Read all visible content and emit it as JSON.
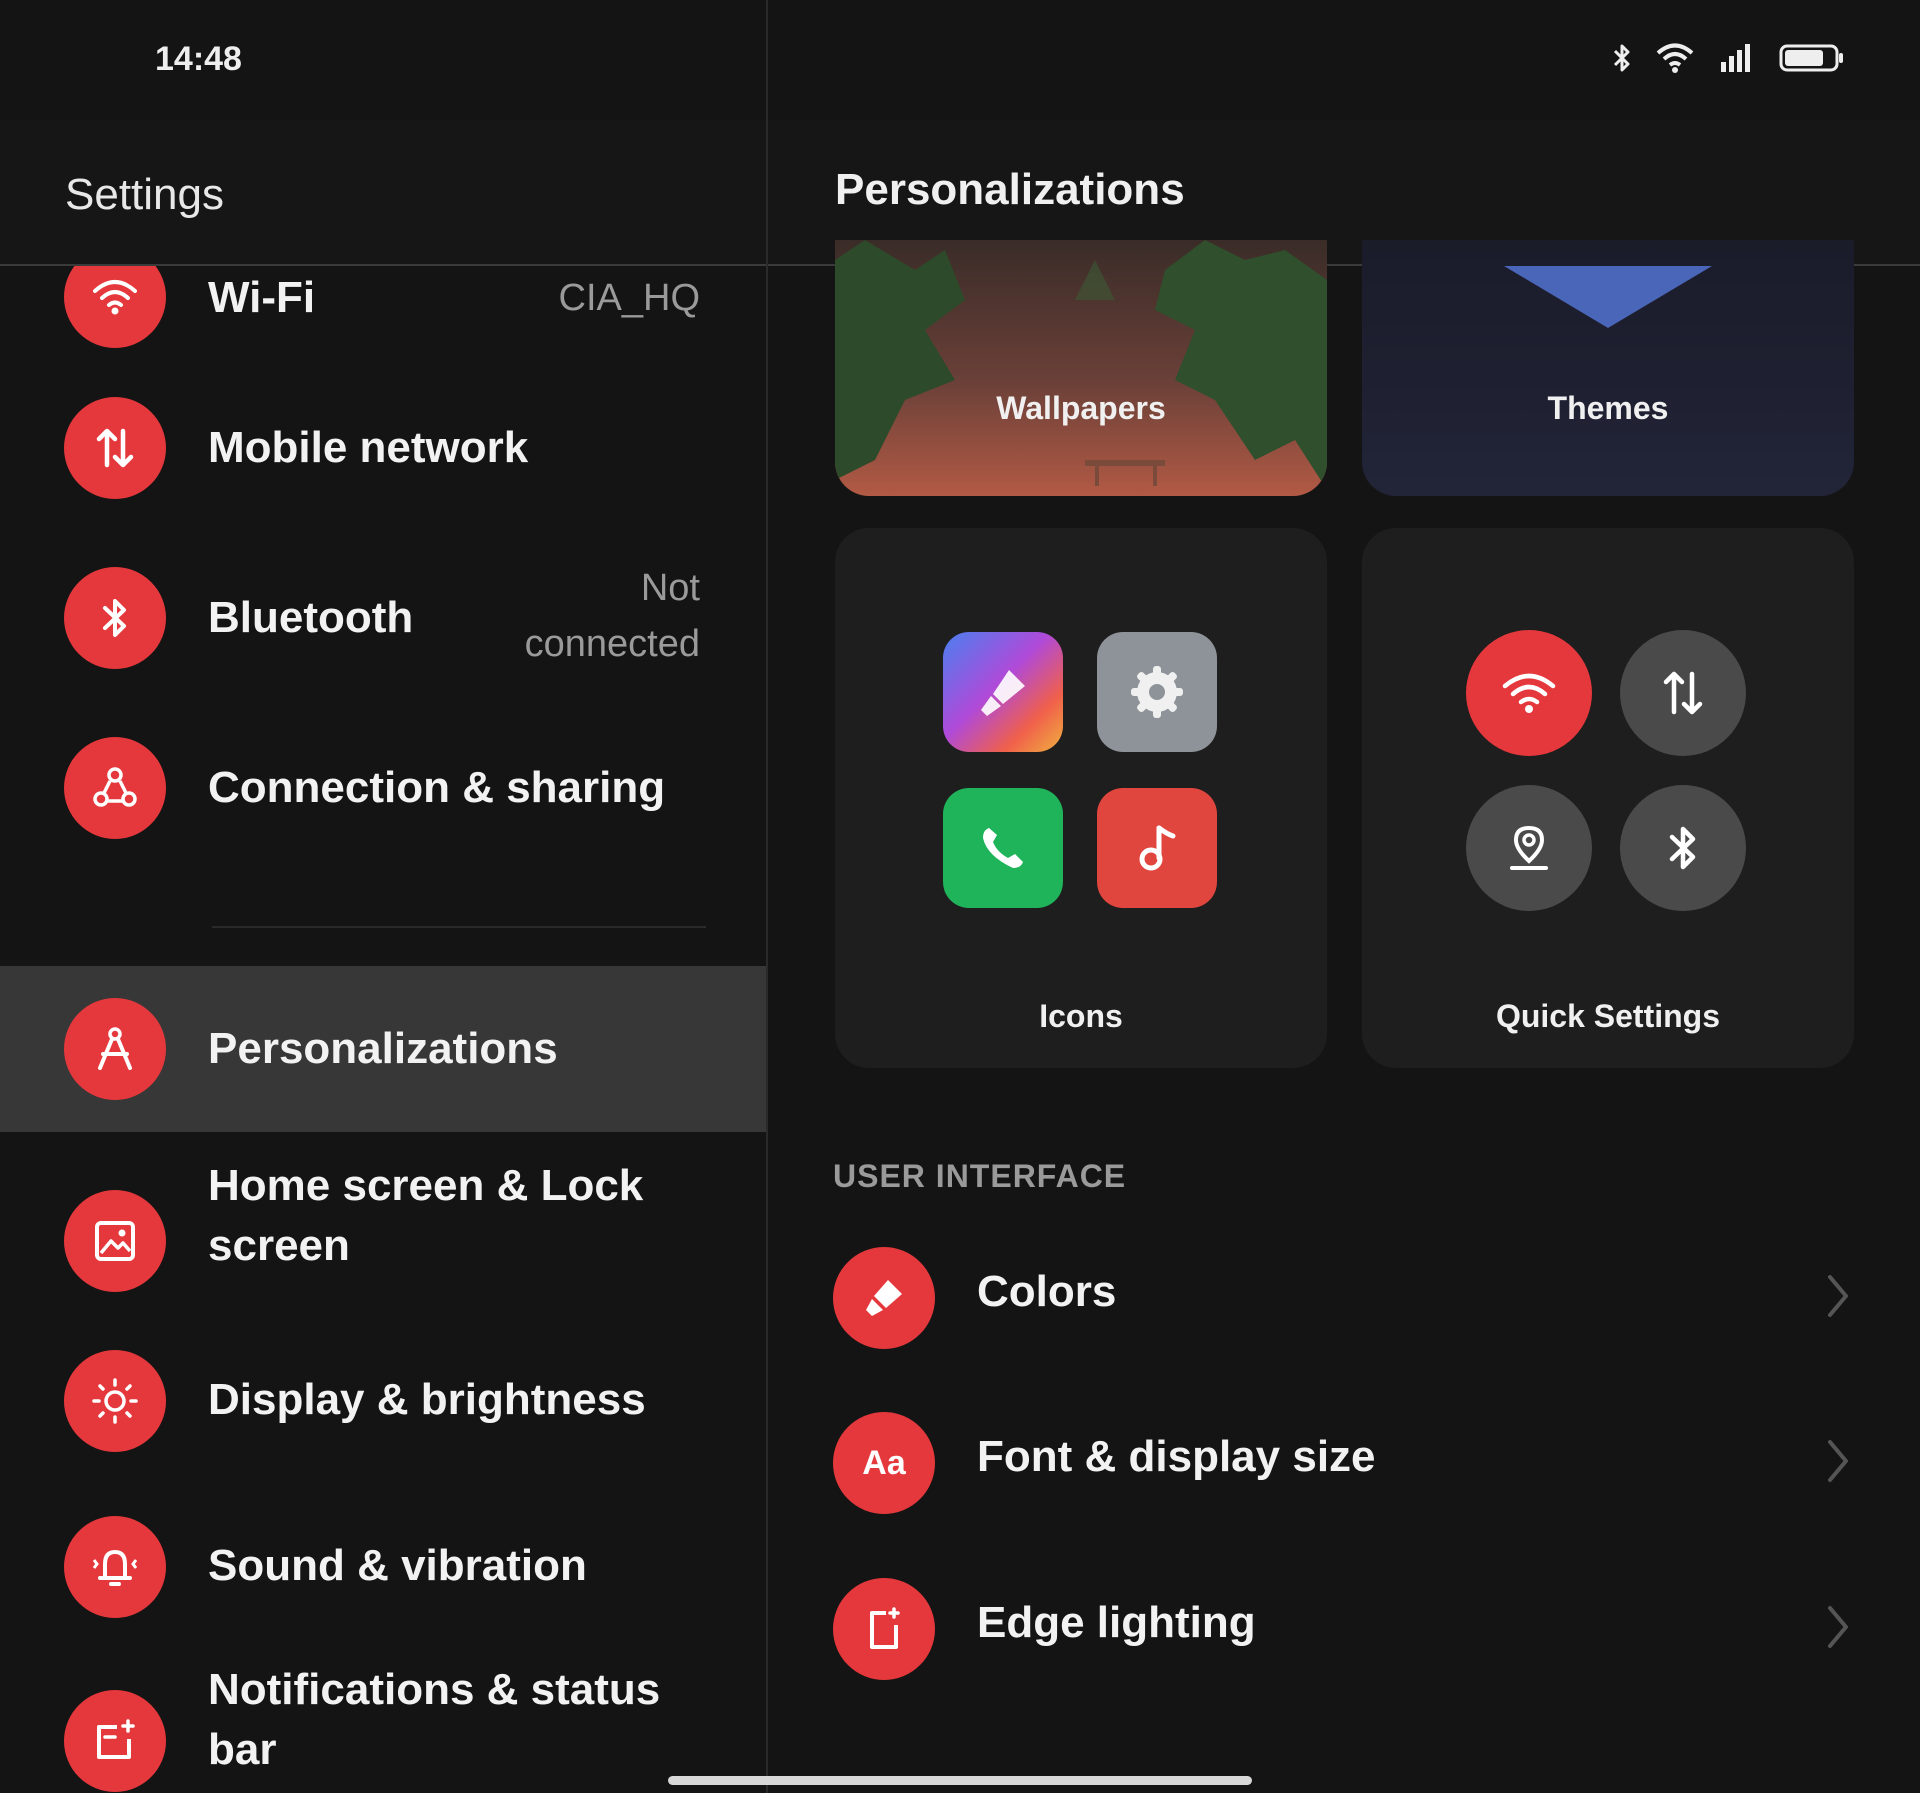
{
  "status_bar": {
    "time": "14:48",
    "icons": [
      "bluetooth-icon",
      "wifi-icon",
      "cellular-signal-icon",
      "battery-icon"
    ]
  },
  "left_pane": {
    "title": "Settings",
    "items": [
      {
        "label": "Wi-Fi",
        "value": "CIA_HQ",
        "icon": "wifi-icon"
      },
      {
        "label": "Mobile network",
        "value": "",
        "icon": "mobile-data-icon"
      },
      {
        "label": "Bluetooth",
        "value_line1": "Not",
        "value_line2": "connected",
        "icon": "bluetooth-icon"
      },
      {
        "label": "Connection & sharing",
        "value": "",
        "icon": "share-icon"
      },
      {
        "label": "Personalizations",
        "value": "",
        "icon": "compass-icon",
        "selected": true
      },
      {
        "label_line1": "Home screen & Lock",
        "label_line2": "screen",
        "icon": "picture-icon"
      },
      {
        "label": "Display & brightness",
        "icon": "sun-icon"
      },
      {
        "label": "Sound & vibration",
        "icon": "bell-icon"
      },
      {
        "label_line1": "Notifications & status",
        "label_line2": "bar",
        "icon": "notification-icon"
      }
    ]
  },
  "right_pane": {
    "title": "Personalizations",
    "cards": {
      "wallpapers": "Wallpapers",
      "themes": "Themes",
      "icons": "Icons",
      "quick_settings": "Quick Settings"
    },
    "section_user_interface": "USER INTERFACE",
    "ui_items": [
      {
        "label": "Colors",
        "icon": "brush-icon"
      },
      {
        "label": "Font & display size",
        "icon": "font-icon",
        "glyph": "Aa"
      },
      {
        "label": "Edge lighting",
        "icon": "edge-lighting-icon"
      }
    ]
  },
  "colors": {
    "accent": "#e5383c",
    "background": "#141414",
    "selected_row": "#373737",
    "secondary_text": "#9a9a9a"
  }
}
